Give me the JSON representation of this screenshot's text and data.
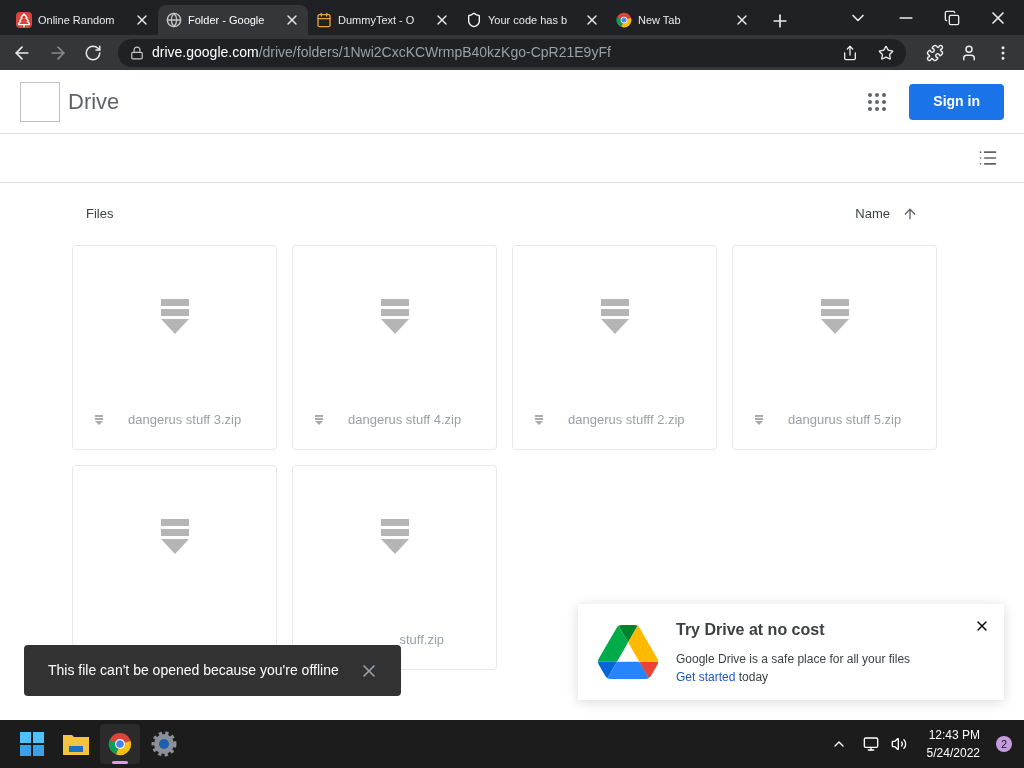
{
  "browser": {
    "tabs": [
      {
        "title": "Online Random",
        "kind": "tree",
        "selected": false
      },
      {
        "title": "Folder - Google",
        "kind": "globe",
        "selected": true
      },
      {
        "title": "DummyText - O",
        "kind": "calendar",
        "selected": false
      },
      {
        "title": "Your code has b",
        "kind": "shield",
        "selected": false
      },
      {
        "title": "New Tab",
        "kind": "chrome",
        "selected": false
      }
    ],
    "url_host": "drive.google.com",
    "url_path": "/drive/folders/1Nwi2CxcKCWrmpB40kzKgo-CpR21E9yFf"
  },
  "header": {
    "title": "Drive",
    "sign_in": "Sign in"
  },
  "files": {
    "heading": "Files",
    "sort_label": "Name",
    "items": [
      {
        "name": "dangerus stuff 3.zip",
        "clipped": false
      },
      {
        "name": "dangerus stuff 4.zip",
        "clipped": false
      },
      {
        "name": "dangerus stufff 2.zip",
        "clipped": false
      },
      {
        "name": "dangurus stuff 5.zip",
        "clipped": false
      },
      {
        "clipped": true
      },
      {
        "name": "stuff.zip",
        "clipped": true
      }
    ]
  },
  "toast": {
    "message": "This file can't be opened because you're offline"
  },
  "promo": {
    "title": "Try Drive at no cost",
    "body": "Google Drive is a safe place for all your files",
    "link": "Get started",
    "tail": "today"
  },
  "taskbar": {
    "apps": [
      {
        "kind": "start",
        "active": false
      },
      {
        "kind": "folder",
        "active": false
      },
      {
        "kind": "chrome",
        "active": true
      },
      {
        "kind": "settings",
        "active": false
      }
    ],
    "time": "12:43 PM",
    "date": "5/24/2022",
    "notifications": "2"
  }
}
